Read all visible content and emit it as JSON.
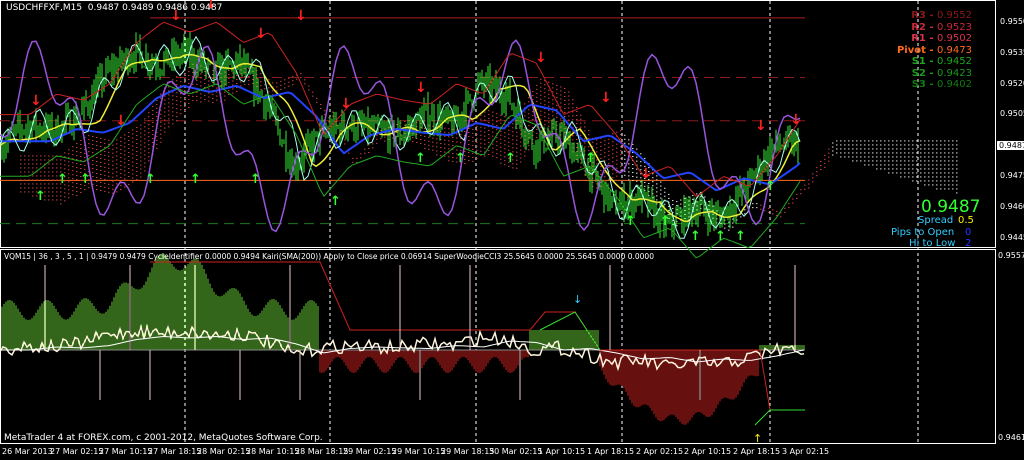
{
  "header": {
    "symbol": "USDCHFFXF,M15",
    "ohlc": "0.9487 0.9489 0.9486 0.9487"
  },
  "pivots": [
    {
      "label": "R3",
      "value": "0.9552",
      "color": "#8b1a1a"
    },
    {
      "label": "R2",
      "value": "0.9523",
      "color": "#c8283c"
    },
    {
      "label": "R1",
      "value": "0.9502",
      "color": "#dc3250"
    },
    {
      "label": "Pivot",
      "value": "0.9473",
      "color": "#ff6a1a"
    },
    {
      "label": "S1",
      "value": "0.9452",
      "color": "#1fa81f"
    },
    {
      "label": "S2",
      "value": "0.9423",
      "color": "#1a9a1a"
    },
    {
      "label": "S3",
      "value": "0.9402",
      "color": "#137a13"
    }
  ],
  "info": {
    "price": "0.9487",
    "spread_label": "Spread",
    "spread": "0.5",
    "pips_label": "Pips to Open",
    "pips": "0",
    "hilo_label": "Hi to Low",
    "hilo": "2"
  },
  "price_axis": [
    "0.9550",
    "0.9535",
    "0.9520",
    "0.9505",
    "0.9490",
    "0.9475",
    "0.9460",
    "0.9445"
  ],
  "current_price_tag": "0.9487",
  "indicator": {
    "header": "VQM15 | 36 , 3 , 5 , 1  |  0.9479 0.9479  CycleIdentifier 0.0000 0.9494  Kairi(SMA(200)) Apply to Close price 0.06914  SuperWoodieCCI3 25.5645 0.0000 25.5645 0.0000 0.0000",
    "axis_top": "0.9557",
    "axis_bottom": "0.9461"
  },
  "footer": "MetaTrader 4 at FOREX.com, c 2001-2012, MetaQuotes Software Corp.",
  "time_axis": [
    "26 Mar 2013",
    "27 Mar 02:15",
    "27 Mar 10:15",
    "27 Mar 18:15",
    "28 Mar 02:15",
    "28 Mar 10:15",
    "28 Mar 18:15",
    "29 Mar 02:15",
    "29 Mar 10:15",
    "29 Mar 18:15",
    "30 Mar 02:15",
    "1 Apr 10:15",
    "1 Apr 18:15",
    "2 Apr 02:15",
    "2 Apr 10:15",
    "2 Apr 18:15",
    "3 Apr 02:15"
  ],
  "chart_data": {
    "type": "line",
    "close_path": [
      0.949,
      0.95,
      0.9497,
      0.9505,
      0.9525,
      0.9535,
      0.953,
      0.9535,
      0.9525,
      0.953,
      0.951,
      0.948,
      0.9495,
      0.95,
      0.9497,
      0.9495,
      0.9505,
      0.95,
      0.952,
      0.9515,
      0.949,
      0.9495,
      0.948,
      0.946,
      0.9465,
      0.945,
      0.946,
      0.9455,
      0.947,
      0.949,
      0.949
    ],
    "levels": {
      "r3": 0.9552,
      "r2": 0.9523,
      "r1": 0.9502,
      "pivot": 0.9473,
      "s1": 0.9452
    }
  }
}
